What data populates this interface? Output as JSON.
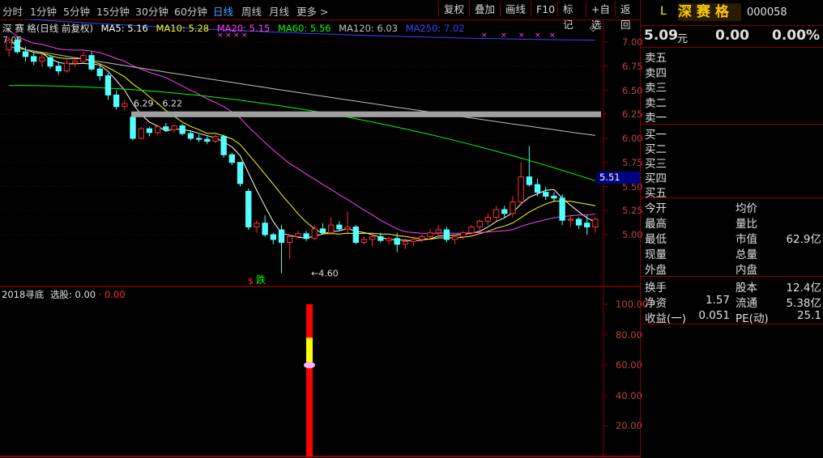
{
  "toolbar": {
    "periods": [
      "分时",
      "1分钟",
      "5分钟",
      "15分钟",
      "30分钟",
      "60分钟",
      "日线",
      "周线",
      "月线",
      "更多 >"
    ],
    "active_period": "日线",
    "buttons": [
      "复权",
      "叠加",
      "画线",
      "F10",
      "标记",
      "+自选",
      "返回"
    ]
  },
  "chart": {
    "stock_name": "深 赛 格",
    "chart_mode": "(日线 前复权)",
    "ma": [
      {
        "label": "MA5: 5.16",
        "color": "#ffffff"
      },
      {
        "label": "MA10: 5.28",
        "color": "#ffff00"
      },
      {
        "label": "MA20: 5.15",
        "color": "#ff40ff"
      },
      {
        "label": "MA60: 5.56",
        "color": "#00ff00"
      },
      {
        "label": "MA120: 6.03",
        "color": "#c0c0c0"
      },
      {
        "label": "MA250: 7.02",
        "color": "#4040ff"
      }
    ],
    "corner_label": "7.05",
    "price_axis": [
      "7.00",
      "6.75",
      "6.50",
      "6.25",
      "6.00",
      "5.75",
      "5.50",
      "5.25",
      "5.00"
    ],
    "price_range": [
      4.5,
      7.2
    ],
    "annotation_gap": "6.29 - 6.22",
    "annotation_low": "4.60",
    "current_price_tag": "5.51",
    "signal_text": "跌",
    "signal_mark": "$",
    "candles": [
      [
        6.92,
        7.05,
        6.85,
        7.02
      ],
      [
        7.02,
        7.06,
        6.88,
        6.9
      ],
      [
        6.9,
        6.95,
        6.8,
        6.85
      ],
      [
        6.85,
        6.9,
        6.76,
        6.8
      ],
      [
        6.8,
        6.88,
        6.74,
        6.84
      ],
      [
        6.84,
        6.86,
        6.72,
        6.75
      ],
      [
        6.75,
        6.8,
        6.66,
        6.7
      ],
      [
        6.7,
        6.82,
        6.68,
        6.78
      ],
      [
        6.78,
        6.85,
        6.74,
        6.8
      ],
      [
        6.8,
        6.9,
        6.78,
        6.86
      ],
      [
        6.86,
        6.9,
        6.7,
        6.72
      ],
      [
        6.72,
        6.76,
        6.6,
        6.65
      ],
      [
        6.65,
        6.68,
        6.4,
        6.45
      ],
      [
        6.45,
        6.5,
        6.3,
        6.33
      ],
      [
        6.33,
        6.4,
        6.29,
        6.36
      ],
      [
        6.22,
        6.25,
        5.98,
        6.0
      ],
      [
        6.0,
        6.12,
        5.99,
        6.1
      ],
      [
        6.1,
        6.12,
        6.02,
        6.06
      ],
      [
        6.06,
        6.14,
        6.03,
        6.12
      ],
      [
        6.12,
        6.16,
        6.08,
        6.09
      ],
      [
        6.09,
        6.14,
        6.06,
        6.13
      ],
      [
        6.13,
        6.15,
        6.03,
        6.05
      ],
      [
        6.05,
        6.08,
        5.98,
        6.0
      ],
      [
        6.0,
        6.04,
        5.96,
        5.99
      ],
      [
        5.99,
        6.02,
        5.94,
        5.97
      ],
      [
        5.97,
        6.04,
        5.95,
        6.02
      ],
      [
        6.02,
        6.04,
        5.8,
        5.83
      ],
      [
        5.83,
        5.85,
        5.72,
        5.75
      ],
      [
        5.75,
        5.76,
        5.5,
        5.53
      ],
      [
        5.45,
        5.48,
        5.05,
        5.08
      ],
      [
        5.08,
        5.15,
        5.02,
        5.12
      ],
      [
        5.12,
        5.2,
        4.98,
        5.0
      ],
      [
        5.0,
        5.02,
        4.9,
        4.95
      ],
      [
        5.05,
        5.1,
        4.6,
        4.92
      ],
      [
        4.92,
        5.0,
        4.75,
        4.98
      ],
      [
        4.98,
        5.04,
        4.96,
        5.01
      ],
      [
        5.01,
        5.04,
        4.93,
        4.96
      ],
      [
        4.96,
        5.1,
        4.94,
        5.06
      ],
      [
        5.06,
        5.12,
        5.0,
        5.02
      ],
      [
        5.02,
        5.18,
        5.0,
        5.1
      ],
      [
        5.1,
        5.14,
        5.04,
        5.06
      ],
      [
        5.06,
        5.24,
        5.02,
        5.08
      ],
      [
        5.08,
        5.1,
        4.9,
        4.92
      ],
      [
        4.92,
        4.98,
        4.9,
        4.95
      ],
      [
        4.95,
        5.0,
        4.88,
        4.98
      ],
      [
        4.98,
        5.02,
        4.92,
        4.94
      ],
      [
        4.94,
        4.98,
        4.9,
        4.96
      ],
      [
        4.96,
        5.02,
        4.82,
        4.9
      ],
      [
        4.9,
        4.96,
        4.85,
        4.93
      ],
      [
        4.93,
        4.98,
        4.88,
        4.95
      ],
      [
        4.95,
        5.0,
        4.92,
        4.98
      ],
      [
        4.98,
        5.06,
        4.94,
        5.02
      ],
      [
        5.02,
        5.1,
        4.98,
        5.05
      ],
      [
        5.05,
        5.08,
        4.92,
        4.95
      ],
      [
        4.95,
        5.0,
        4.9,
        4.98
      ],
      [
        4.98,
        5.04,
        4.95,
        5.02
      ],
      [
        5.02,
        5.1,
        5.0,
        5.08
      ],
      [
        5.08,
        5.16,
        5.04,
        5.14
      ],
      [
        5.14,
        5.22,
        5.1,
        5.18
      ],
      [
        5.18,
        5.3,
        5.14,
        5.26
      ],
      [
        5.26,
        5.3,
        5.18,
        5.22
      ],
      [
        5.22,
        5.4,
        5.18,
        5.34
      ],
      [
        5.34,
        5.75,
        5.3,
        5.6
      ],
      [
        5.6,
        5.92,
        5.5,
        5.52
      ],
      [
        5.52,
        5.58,
        5.4,
        5.44
      ],
      [
        5.44,
        5.5,
        5.36,
        5.4
      ],
      [
        5.4,
        5.44,
        5.34,
        5.38
      ],
      [
        5.38,
        5.42,
        5.1,
        5.15
      ],
      [
        5.15,
        5.2,
        5.08,
        5.16
      ],
      [
        5.16,
        5.18,
        5.06,
        5.1
      ],
      [
        5.12,
        5.2,
        5.0,
        5.08
      ],
      [
        5.08,
        5.18,
        5.02,
        5.16
      ]
    ],
    "sell_markers": 5
  },
  "indicator": {
    "name": "2018寻底",
    "value_label": "选股: 0.00",
    "value2": "· 0.00",
    "axis": [
      "100.00",
      "80.00",
      "60.00",
      "40.00",
      "20.00"
    ]
  },
  "quote": {
    "code_prefix": "L",
    "name": "深 赛 格",
    "code": "000058",
    "price": "5.09",
    "price_unit": "元",
    "change": "0.00",
    "change_pct": "0.00%",
    "asks": [
      "卖五",
      "卖四",
      "卖三",
      "卖二",
      "卖一"
    ],
    "bids": [
      "买一",
      "买二",
      "买三",
      "买四",
      "买五"
    ],
    "stats": [
      {
        "l": "今开",
        "lv": "",
        "r": "均价",
        "rv": ""
      },
      {
        "l": "最高",
        "lv": "",
        "r": "量比",
        "rv": ""
      },
      {
        "l": "最低",
        "lv": "",
        "r": "市值",
        "rv": "62.9亿"
      },
      {
        "l": "现量",
        "lv": "",
        "r": "总量",
        "rv": ""
      },
      {
        "l": "外盘",
        "lv": "",
        "r": "内盘",
        "rv": ""
      }
    ],
    "finance": [
      {
        "l": "换手",
        "lv": "",
        "r": "股本",
        "rv": "12.4亿"
      },
      {
        "l": "净资",
        "lv": "1.57",
        "r": "流通",
        "rv": "5.38亿"
      },
      {
        "l": "收益(一)",
        "lv": "0.051",
        "r": "PE(动)",
        "rv": "25.1"
      }
    ]
  },
  "colors": {
    "up": "#ff3030",
    "down": "#54ffff",
    "frame": "#8b0000",
    "axis_text": "#c04040",
    "quote_yellow": "#ffff00",
    "name_bg": "#ffcc00"
  }
}
